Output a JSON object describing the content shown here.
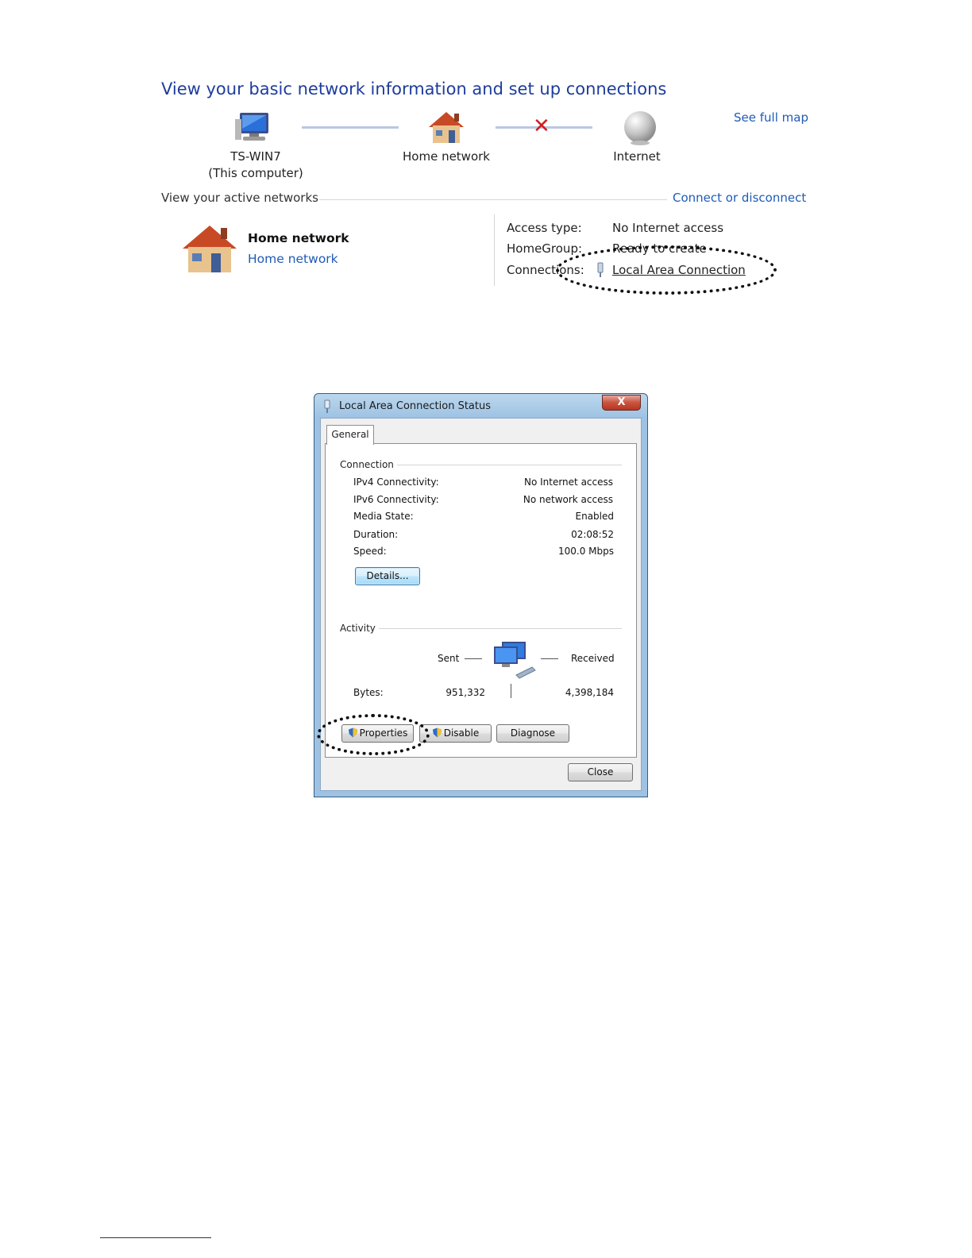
{
  "network_center": {
    "title": "View your basic network information and set up connections",
    "see_full_map": "See full map",
    "map": {
      "computer_name": "TS-WIN7",
      "computer_note": "(This computer)",
      "network_label": "Home network",
      "internet_label": "Internet"
    },
    "active_networks_label": "View your active networks",
    "connect_or_disconnect": "Connect or disconnect",
    "active_network": {
      "name": "Home network",
      "type_link": "Home network",
      "access_type_label": "Access type:",
      "access_type_value": "No Internet access",
      "homegroup_label": "HomeGroup:",
      "homegroup_value": "Ready to create",
      "connections_label": "Connections:",
      "connections_value": "Local Area Connection"
    }
  },
  "dialog": {
    "title": "Local Area Connection Status",
    "close_glyph": "X",
    "tab": "General",
    "connection_section": "Connection",
    "rows": [
      {
        "key": "IPv4 Connectivity:",
        "value": "No Internet access"
      },
      {
        "key": "IPv6 Connectivity:",
        "value": "No network access"
      },
      {
        "key": "Media State:",
        "value": "Enabled"
      },
      {
        "key": "Duration:",
        "value": "02:08:52"
      },
      {
        "key": "Speed:",
        "value": "100.0 Mbps"
      }
    ],
    "details_button": "Details...",
    "activity_section": "Activity",
    "sent_label": "Sent",
    "received_label": "Received",
    "bytes_label": "Bytes:",
    "bytes_sent": "951,332",
    "bytes_received": "4,398,184",
    "properties_button": "Properties",
    "disable_button": "Disable",
    "diagnose_button": "Diagnose",
    "close_button": "Close"
  },
  "colors": {
    "link": "#1e5bb7",
    "title": "#1e3c9c",
    "dialog_frame": "#9dc2e3",
    "close_red": "#c8543f",
    "annotation": "#111111"
  }
}
